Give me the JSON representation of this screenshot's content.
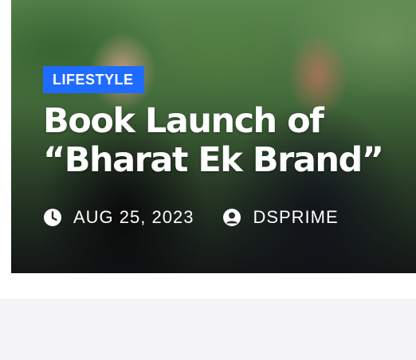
{
  "post": {
    "category": "LIFESTYLE",
    "title": "Book Launch of “Bharat Ek Brand”",
    "date": "AUG 25, 2023",
    "author": "DSPRIME"
  },
  "icons": {
    "date": "clock-icon",
    "author": "user-circle-icon"
  },
  "colors": {
    "badge": "#1f6bff",
    "text": "#ffffff",
    "page_background": "#f4f4f6"
  }
}
